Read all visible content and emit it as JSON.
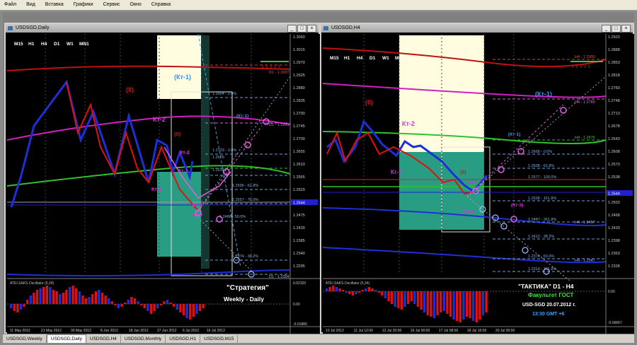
{
  "menu": [
    "Файл",
    "Вид",
    "Вставка",
    "Графики",
    "Сервис",
    "Окно",
    "Справка"
  ],
  "window_buttons": [
    "_",
    "□",
    "×"
  ],
  "left": {
    "title": "USDSGD,Daily",
    "timeframes": [
      "M15",
      "H1",
      "H4",
      "D1",
      "W1",
      "MN1"
    ],
    "price_labels": [
      "1.3060",
      "1.3015",
      "1.2970",
      "1.2925",
      "1.2880",
      "1.2835",
      "1.2790",
      "1.2745",
      "1.2700",
      "1.2655",
      "1.2610",
      "1.2565",
      "1.2520",
      "1.2475",
      "1.2430",
      "1.2385",
      "1.2340",
      "1.2295"
    ],
    "current_price": "1.2544",
    "date_labels": [
      "11 May 2012",
      "21 May 2012",
      "30 May 2012",
      "8 Jun 2012",
      "18 Jun 2012",
      "27 Jun 2012",
      "6 Jul 2012",
      "16 Jul 2012"
    ],
    "annotations": {
      "zero": "(0)",
      "zero2": "(0)",
      "kt1_top": "(Кт-1)",
      "kt2": "Кт-2",
      "kt2b": "Кт-2",
      "kt1a": "Кт-1",
      "kt1b": "Кт-1",
      "kt3": "Кт-3",
      "kt3b": "Кт-3",
      "kt1_small": "(Кт-1)"
    },
    "levels": {
      "d1_top": "D1 - 1.3007",
      "fib1": "1.2904 - 2.0%",
      "d1_mid": "D1 - 1.2831",
      "fib2": "1.2703 - 3.0%",
      "fib3": "1.2676",
      "fib4": "1.2634",
      "fib5": "1.2595 - 61.8%",
      "fib6": "1.2557 - 76.0%",
      "d1_low": "D1 - 1.2304",
      "fib7": "1.2374 - 38.2%",
      "fib8": "1.2486 - 50.0%"
    },
    "osc_title": "ATEI.SAKS.Oscillator (5,34)",
    "osc_labels": [
      "0.02103",
      "0.00",
      "-0.01880"
    ],
    "strategy_title": "\"Стратегия\"",
    "strategy_sub": "Weekly - Daily"
  },
  "right": {
    "title": "USDSGD,H4",
    "timeframes": [
      "M15",
      "H1",
      "H4",
      "D1",
      "W1",
      "MN1"
    ],
    "price_labels": [
      "1.2923",
      "1.2888",
      "1.2853",
      "1.2818",
      "1.2783",
      "1.2748",
      "1.2713",
      "1.2678",
      "1.2643",
      "1.2608",
      "1.2573",
      "1.2538",
      "1.2503",
      "1.2468",
      "1.2433",
      "1.2398",
      "1.2363",
      "1.2328"
    ],
    "current_price": "1.2544",
    "date_labels": [
      "10 Jul 2012",
      "11 Jul 12:00",
      "12 Jul 20:00",
      "16 Jul 00:00",
      "17 Jul 08:00",
      "18 Jul 16:00",
      "20 Jul 00:00"
    ],
    "annotations": {
      "zero": "(0)",
      "kt1_top": "(Кт-1)",
      "kt2": "Кт-2",
      "kt1": "Кт-1",
      "zero2": "(0)",
      "kt3": "Кт-3",
      "kt3b": "(Кт-3)",
      "kt1_small": "(Кт-1)",
      "kt2_small": "Кт-2"
    },
    "levels": {
      "h4_top": "H4 - 1.2900",
      "h4_2": "H4 - 1.2789",
      "h4_3": "H4 - 1.2676",
      "h4_4": "H4 - 1.2457",
      "h4_5": "H4 - 1.2347",
      "fib1": "1.2668 - 0.0%",
      "fib2": "1.2608 - 61.8%",
      "fib3": "1.2577 - 100.0%",
      "fib4": "1.2538 - 161.8%",
      "fib5": "1.2487 - 261.8%",
      "fib6": "1.2412 - 38.2%",
      "fib7": "1.2374 - 50.0%",
      "fib8": "1.2314 - 161.8%"
    },
    "osc_title": "ATEI.SAKS.Oscillator (5,34)",
    "osc_labels": [
      "0.00",
      "-0.00667"
    ],
    "info": {
      "title": "\"ТАКТИКА\"   D1 - H4",
      "faculty": "Факультет ГОСТ",
      "pair_date": "USD-SGD   20.07.2012 г.",
      "time": "13:30   GMT +6"
    }
  },
  "tabs": [
    "USDSGD,Weekly",
    "USDSGD,Daily",
    "USDSGD,H4",
    "USDSGD,Monthly",
    "USDSGD,H1",
    "USDSGD,M15"
  ],
  "active_tab": "USDSGD,Daily",
  "colors": {
    "bull": "#1e2fd8",
    "bear": "#e01010",
    "fib_zone": "#fffce0",
    "teal_zone": "#38c8a8",
    "magenta": "#e030e0",
    "green_ma": "#40c040",
    "red_ma": "#c01010"
  }
}
